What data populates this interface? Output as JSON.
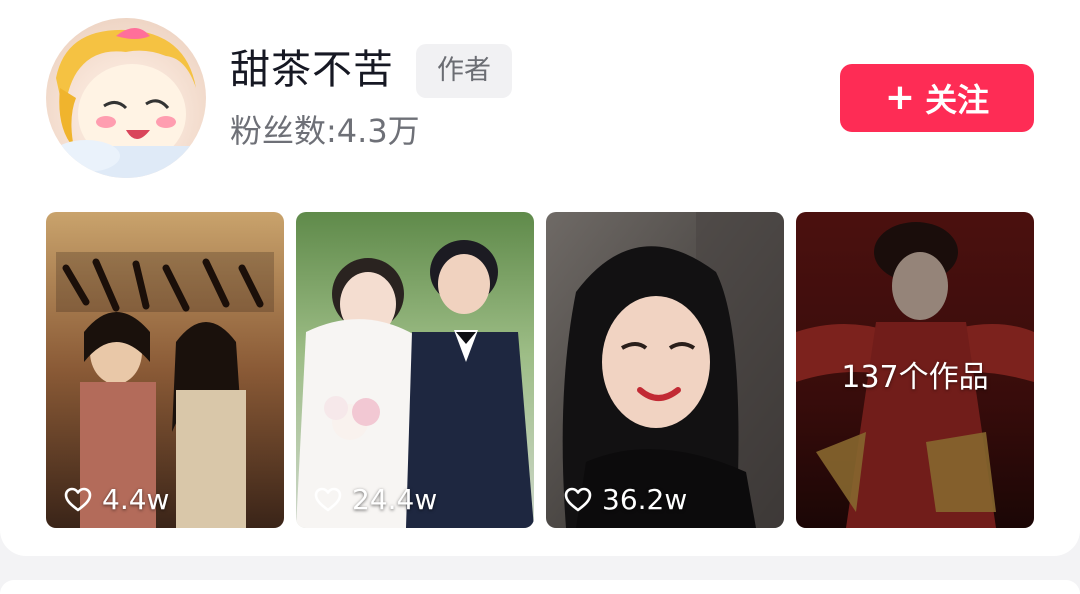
{
  "author": {
    "name": "甜茶不苦",
    "badge": "作者",
    "fans": "粉丝数:4.3万"
  },
  "follow_button": {
    "plus": "+",
    "label": "关注"
  },
  "videos": [
    {
      "likes": "4.4w"
    },
    {
      "likes": "24.4w"
    },
    {
      "likes": "36.2w"
    }
  ],
  "more_works": {
    "count_label": "137个作品"
  },
  "colors": {
    "accent": "#fe2c55",
    "title": "#161823",
    "secondary": "#6e7077"
  },
  "icons": {
    "like": "heart-outline-icon",
    "follow": "plus-icon"
  }
}
